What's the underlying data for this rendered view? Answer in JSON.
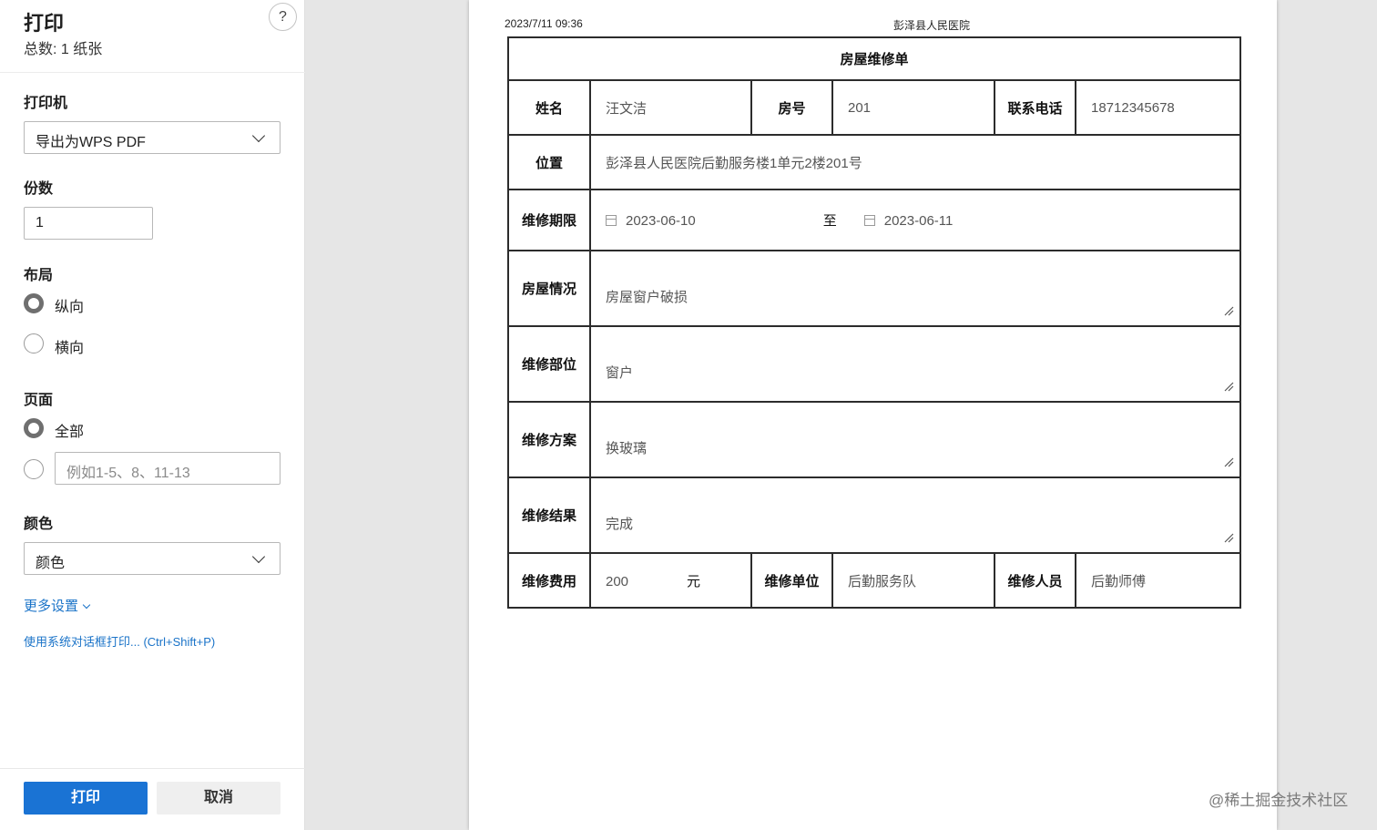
{
  "print_panel": {
    "title": "打印",
    "count": "总数: 1 纸张",
    "help": "?",
    "printer": {
      "label": "打印机",
      "value": "导出为WPS PDF"
    },
    "copies": {
      "label": "份数",
      "value": "1"
    },
    "layout": {
      "label": "布局",
      "options": [
        {
          "label": "纵向",
          "selected": true
        },
        {
          "label": "横向",
          "selected": false
        }
      ]
    },
    "pages": {
      "label": "页面",
      "all_label": "全部",
      "range_placeholder": "例如1-5、8、11-13"
    },
    "color": {
      "label": "颜色",
      "value": "颜色"
    },
    "more_settings": "更多设置",
    "system_dialog": "使用系统对话框打印... (Ctrl+Shift+P)",
    "print_button": "打印",
    "cancel_button": "取消"
  },
  "preview": {
    "header_date": "2023/7/11 09:36",
    "header_site": "彭泽县人民医院",
    "form": {
      "title": "房屋维修单",
      "name_label": "姓名",
      "name": "汪文洁",
      "room_label": "房号",
      "room": "201",
      "phone_label": "联系电话",
      "phone": "18712345678",
      "location_label": "位置",
      "location": "彭泽县人民医院后勤服务楼1单元2楼201号",
      "period_label": "维修期限",
      "start_date": "2023-06-10",
      "to": "至",
      "end_date": "2023-06-11",
      "condition_label": "房屋情况",
      "condition": "房屋窗户破损",
      "part_label": "维修部位",
      "part": "窗户",
      "plan_label": "维修方案",
      "plan": "换玻璃",
      "result_label": "维修结果",
      "result": "完成",
      "cost_label": "维修费用",
      "cost": "200",
      "cost_unit": "元",
      "unit_label": "维修单位",
      "unit": "后勤服务队",
      "worker_label": "维修人员",
      "worker": "后勤师傅"
    }
  },
  "watermark": "@稀土掘金技术社区",
  "colors": {
    "primary": "#1a73d4",
    "link": "#1a73c8",
    "page_bg": "#e6e6e6"
  },
  "icons": [
    "help-icon",
    "chevron-down-icon",
    "calendar-icon",
    "resize-grip-icon"
  ]
}
